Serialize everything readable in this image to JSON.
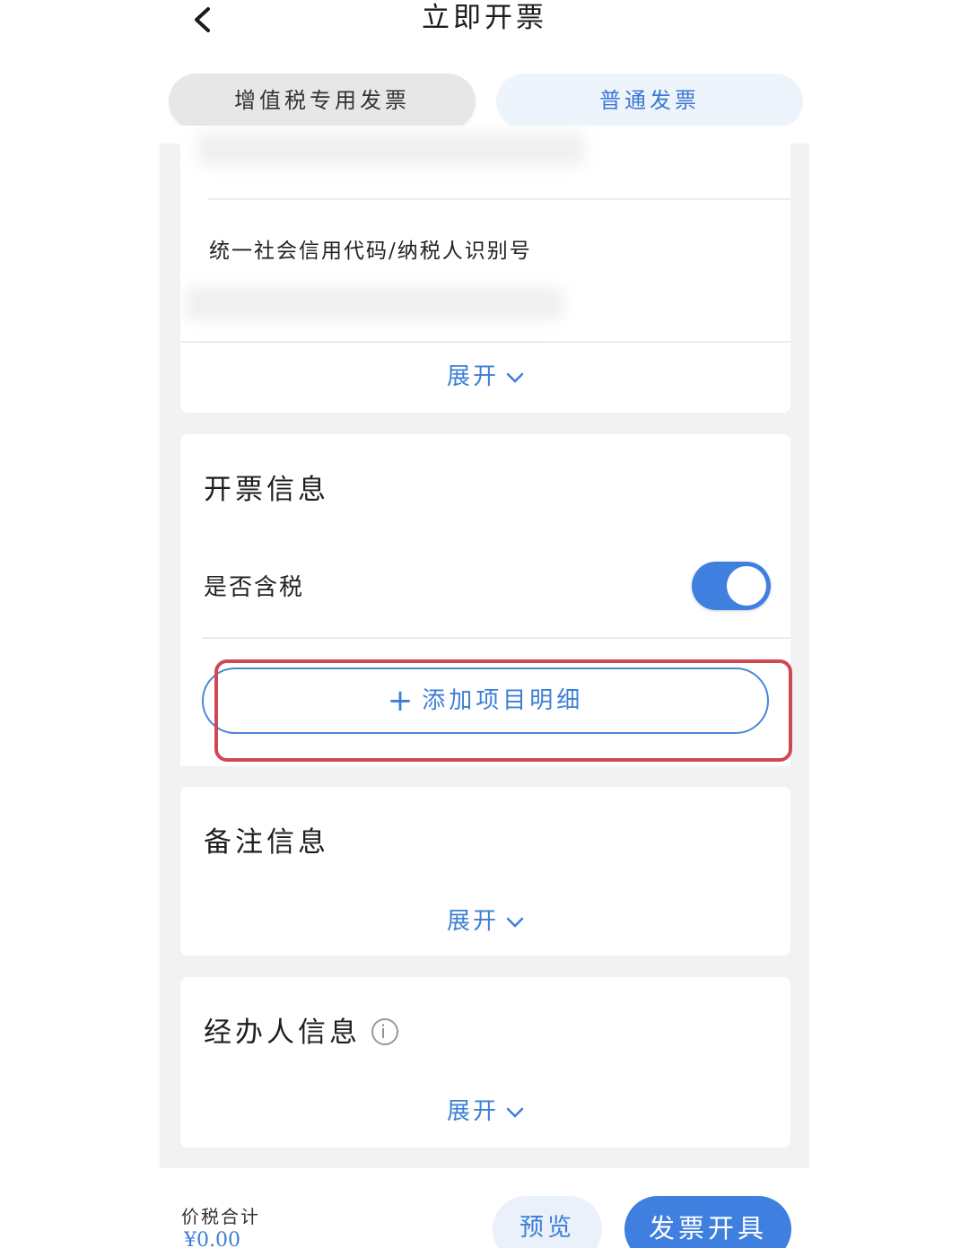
{
  "header": {
    "title": "立即开票"
  },
  "tabs": [
    {
      "label": "增值税专用发票",
      "selected": true
    },
    {
      "label": "普通发票",
      "selected": false
    }
  ],
  "buyer": {
    "tax_id_label": "统一社会信用代码/纳税人识别号",
    "expand_label": "展开"
  },
  "invoice_info": {
    "title": "开票信息",
    "tax_included_label": "是否含税",
    "tax_included": true,
    "add_item_label": "添加项目明细"
  },
  "remarks": {
    "title": "备注信息",
    "expand_label": "展开"
  },
  "handler": {
    "title": "经办人信息",
    "info_icon": "i",
    "expand_label": "展开"
  },
  "footer": {
    "total_label": "价税合计",
    "total_amount": "¥0.00",
    "preview_label": "预览",
    "issue_label": "发票开具"
  },
  "colors": {
    "accent": "#3f7fe0",
    "highlight": "#cc4a55",
    "tab_selected_bg": "#e7e7e7",
    "tab_unselected_bg": "#eef4fc"
  }
}
